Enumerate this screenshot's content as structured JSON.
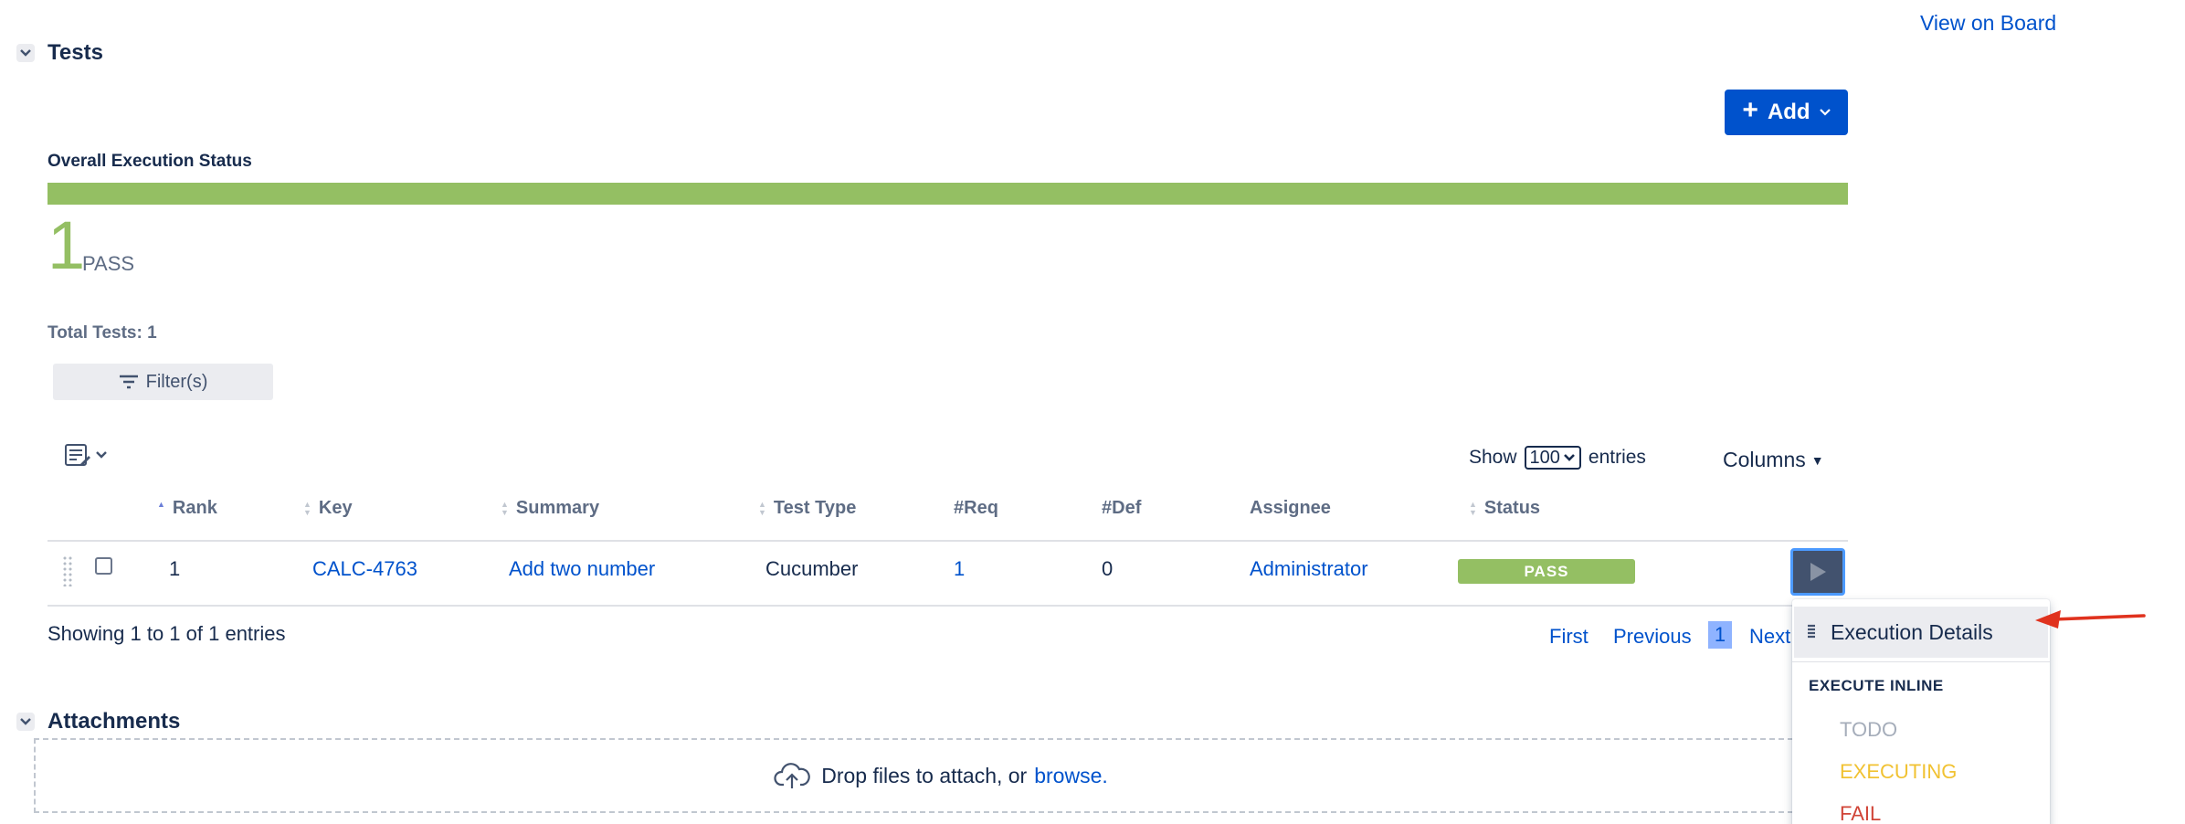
{
  "links": {
    "view_on_board": "View on Board"
  },
  "tests_section": {
    "title": "Tests",
    "add_label": "Add",
    "overall_status_label": "Overall Execution Status",
    "status_breakdown": [
      {
        "status": "PASS",
        "count": "1",
        "fraction": 1.0,
        "color": "#94bf63"
      }
    ],
    "summary_count": "1",
    "summary_label": "PASS",
    "total_tests": "Total Tests: 1",
    "filters_label": "Filter(s)",
    "show_label": "Show",
    "entries_value": "100",
    "entries_label": "entries",
    "columns_label": "Columns",
    "table": {
      "headers": [
        "Rank",
        "Key",
        "Summary",
        "Test Type",
        "#Req",
        "#Def",
        "Assignee",
        "Status"
      ],
      "rows": [
        {
          "rank": "1",
          "key": "CALC-4763",
          "summary": "Add two number",
          "test_type": "Cucumber",
          "req": "1",
          "def": "0",
          "assignee": "Administrator",
          "status": "PASS"
        }
      ]
    },
    "showing_text": "Showing 1 to 1 of 1 entries",
    "pagination": {
      "first": "First",
      "previous": "Previous",
      "current": "1",
      "next": "Next"
    }
  },
  "attachments_section": {
    "title": "Attachments",
    "drop_text": "Drop files to attach, or",
    "browse_text": "browse."
  },
  "execute_menu": {
    "execution_details": "Execution Details",
    "inline_header": "EXECUTE INLINE",
    "options": [
      {
        "label": "TODO",
        "color": "#a5adba"
      },
      {
        "label": "EXECUTING",
        "color": "#f1c232"
      },
      {
        "label": "FAIL",
        "color": "#d04437"
      }
    ]
  },
  "colors": {
    "accent": "#0052cc",
    "pass": "#94bf63",
    "annotation_arrow": "#e0321e"
  }
}
